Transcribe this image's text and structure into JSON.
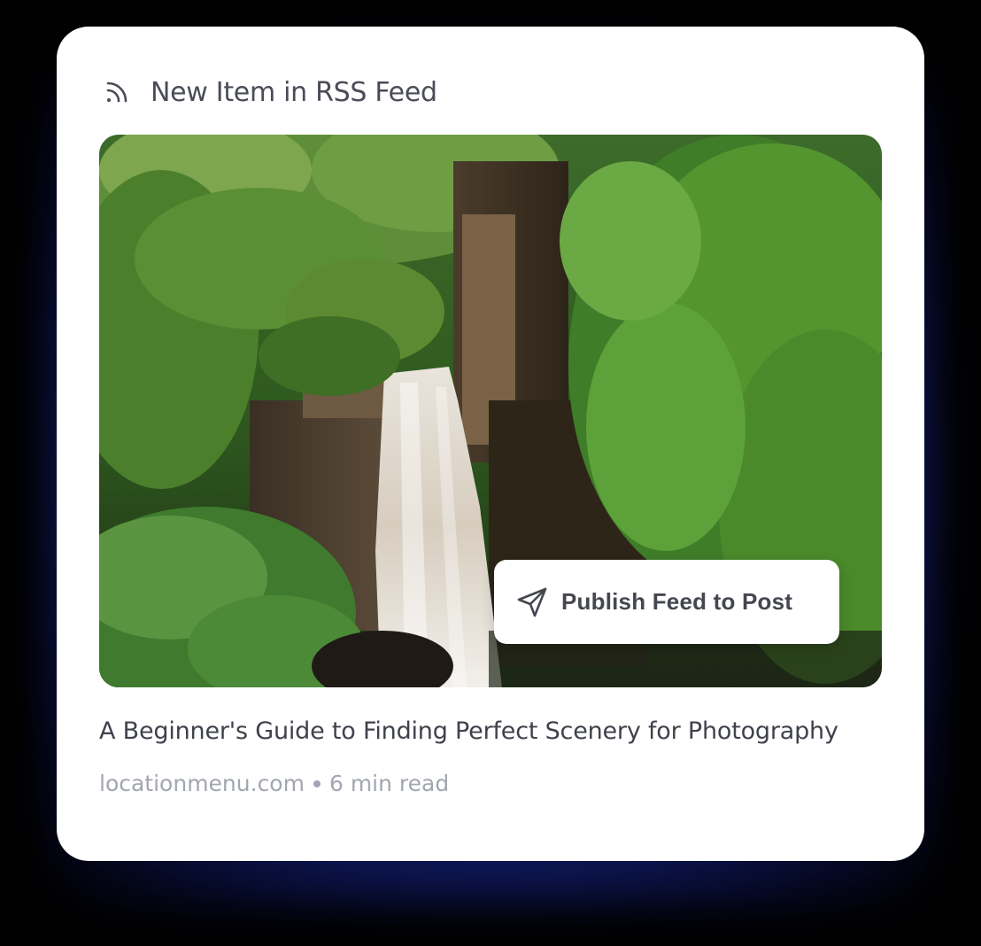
{
  "header": {
    "icon": "rss-icon",
    "title": "New Item in RSS Feed"
  },
  "image": {
    "description_icon": "waterfall-photo"
  },
  "action": {
    "icon": "send-icon",
    "label": "Publish Feed to Post"
  },
  "article": {
    "title": "A Beginner's Guide to Finding Perfect Scenery for Photography",
    "domain": "locationmenu.com",
    "read_time": "6 min read"
  },
  "colors": {
    "card_bg": "#ffffff",
    "text_primary": "#3f424b",
    "text_muted": "#a2a6b0",
    "glow": "#1b2a8a"
  }
}
